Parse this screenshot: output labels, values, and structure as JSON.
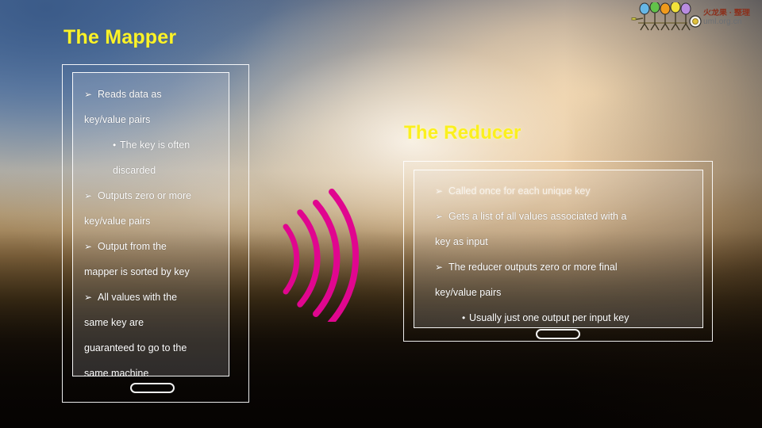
{
  "slide": {
    "mapper_title": "The Mapper",
    "reducer_title": "The Reducer"
  },
  "mapper_panel": {
    "lines": [
      {
        "marker": "➢",
        "text": "Reads data as",
        "level": 1
      },
      {
        "marker": "",
        "text": "key/value pairs",
        "level": 0
      },
      {
        "marker": "•",
        "text": "The key is often",
        "level": 2
      },
      {
        "marker": "",
        "text": "discarded",
        "level": 3
      },
      {
        "marker": "➢",
        "text": "Outputs zero or more",
        "level": 1
      },
      {
        "marker": "",
        "text": "key/value pairs",
        "level": 0
      },
      {
        "marker": "➢",
        "text": "Output from the",
        "level": 1
      },
      {
        "marker": "",
        "text": "mapper is sorted by key",
        "level": 0
      },
      {
        "marker": "➢",
        "text": "All values with the",
        "level": 1
      },
      {
        "marker": "",
        "text": "same key are",
        "level": 0
      },
      {
        "marker": "",
        "text": "guaranteed to go to the",
        "level": 0
      },
      {
        "marker": "",
        "text": "same machine",
        "level": 0
      }
    ]
  },
  "reducer_panel": {
    "lines": [
      {
        "marker": "➢",
        "text": "Called once for each unique key",
        "level": 1,
        "washed": true
      },
      {
        "marker": "➢",
        "text": "Gets a list of all values associated with a",
        "level": 1
      },
      {
        "marker": "",
        "text": "key as input",
        "level": 0
      },
      {
        "marker": "➢",
        "text": "The reducer outputs zero or more final",
        "level": 1
      },
      {
        "marker": "",
        "text": "key/value pairs",
        "level": 0
      },
      {
        "marker": "•",
        "text": "Usually just one output per input key",
        "level": 2
      }
    ]
  },
  "watermark": {
    "cn_text": "火龙果 · 整理",
    "url": "uml.org.cn"
  },
  "colors": {
    "title_yellow": "#fcf328",
    "arc_magenta": "#e0068f",
    "panel_border": "#ffffff",
    "body_text": "#ffffff"
  }
}
